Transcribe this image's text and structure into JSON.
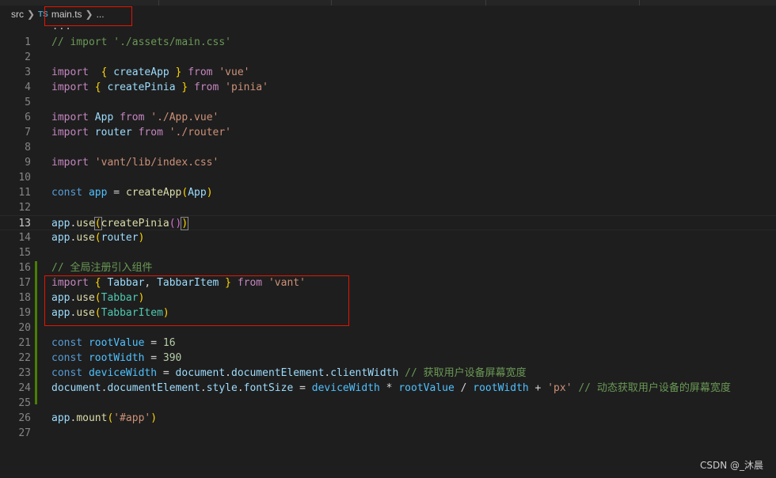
{
  "breadcrumb": {
    "folder": "src",
    "file_badge": "TS",
    "file": "main.ts",
    "tail": "..."
  },
  "sticky": "...",
  "lines": [
    {
      "n": "1",
      "parts": [
        [
          "cm",
          "// import './assets/main.css'"
        ]
      ]
    },
    {
      "n": "2",
      "parts": []
    },
    {
      "n": "3",
      "parts": [
        [
          "kw",
          "import"
        ],
        [
          "",
          "  "
        ],
        [
          "br1",
          "{"
        ],
        [
          "",
          ""
        ],
        [
          "var",
          " createApp "
        ],
        [
          "br1",
          "}"
        ],
        [
          "kw",
          " from "
        ],
        [
          "st",
          "'vue'"
        ]
      ]
    },
    {
      "n": "4",
      "parts": [
        [
          "kw",
          "import"
        ],
        [
          "",
          ""
        ],
        [
          "br1",
          " {"
        ],
        [
          "var",
          " createPinia "
        ],
        [
          "br1",
          "}"
        ],
        [
          "kw",
          " from "
        ],
        [
          "st",
          "'pinia'"
        ]
      ]
    },
    {
      "n": "5",
      "parts": []
    },
    {
      "n": "6",
      "parts": [
        [
          "kw",
          "import"
        ],
        [
          "var",
          " App"
        ],
        [
          "kw",
          " from "
        ],
        [
          "st",
          "'./App.vue'"
        ]
      ]
    },
    {
      "n": "7",
      "parts": [
        [
          "kw",
          "import"
        ],
        [
          "var",
          " router"
        ],
        [
          "kw",
          " from "
        ],
        [
          "st",
          "'./router'"
        ]
      ]
    },
    {
      "n": "8",
      "parts": []
    },
    {
      "n": "9",
      "parts": [
        [
          "kw",
          "import"
        ],
        [
          "st",
          " 'vant/lib/index.css'"
        ]
      ]
    },
    {
      "n": "10",
      "parts": []
    },
    {
      "n": "11",
      "parts": [
        [
          "st-kw",
          "const"
        ],
        [
          "cst",
          " app"
        ],
        [
          "",
          " = "
        ],
        [
          "fn",
          "createApp"
        ],
        [
          "br1",
          "("
        ],
        [
          "var",
          "App"
        ],
        [
          "br1",
          ")"
        ]
      ]
    },
    {
      "n": "12",
      "parts": []
    },
    {
      "n": "13",
      "parts": [
        [
          "var",
          "app"
        ],
        [
          "",
          "."
        ],
        [
          "fn",
          "use"
        ],
        [
          "br1 bm",
          "("
        ],
        [
          "fn",
          "createPinia"
        ],
        [
          "br2",
          "()"
        ],
        [
          "br1 bm",
          ")"
        ]
      ]
    },
    {
      "n": "14",
      "parts": [
        [
          "var",
          "app"
        ],
        [
          "",
          "."
        ],
        [
          "fn",
          "use"
        ],
        [
          "br1",
          "("
        ],
        [
          "var",
          "router"
        ],
        [
          "br1",
          ")"
        ]
      ]
    },
    {
      "n": "15",
      "parts": []
    },
    {
      "n": "16",
      "parts": [
        [
          "cm",
          "// "
        ],
        [
          "cmcn",
          "全局注册引入组件"
        ]
      ]
    },
    {
      "n": "17",
      "parts": [
        [
          "kw",
          "import"
        ],
        [
          "",
          ""
        ],
        [
          "br1",
          " {"
        ],
        [
          "var",
          " Tabbar"
        ],
        [
          "",
          ", "
        ],
        [
          "var",
          "TabbarItem "
        ],
        [
          "br1",
          "}"
        ],
        [
          "kw",
          " from "
        ],
        [
          "st",
          "'vant'"
        ]
      ]
    },
    {
      "n": "18",
      "parts": [
        [
          "var",
          "app"
        ],
        [
          "",
          "."
        ],
        [
          "fn",
          "use"
        ],
        [
          "br1",
          "("
        ],
        [
          "cls",
          "Tabbar"
        ],
        [
          "br1",
          ")"
        ]
      ]
    },
    {
      "n": "19",
      "parts": [
        [
          "var",
          "app"
        ],
        [
          "",
          "."
        ],
        [
          "fn",
          "use"
        ],
        [
          "br1",
          "("
        ],
        [
          "cls",
          "TabbarItem"
        ],
        [
          "br1",
          ")"
        ]
      ]
    },
    {
      "n": "20",
      "parts": []
    },
    {
      "n": "21",
      "parts": [
        [
          "st-kw",
          "const"
        ],
        [
          "cst",
          " rootValue"
        ],
        [
          "",
          " = "
        ],
        [
          "num",
          "16"
        ]
      ]
    },
    {
      "n": "22",
      "parts": [
        [
          "st-kw",
          "const"
        ],
        [
          "cst",
          " rootWidth"
        ],
        [
          "",
          " = "
        ],
        [
          "num",
          "390"
        ]
      ]
    },
    {
      "n": "23",
      "parts": [
        [
          "st-kw",
          "const"
        ],
        [
          "cst",
          " deviceWidth"
        ],
        [
          "",
          " = "
        ],
        [
          "var",
          "document"
        ],
        [
          "",
          "."
        ],
        [
          "var",
          "documentElement"
        ],
        [
          "",
          "."
        ],
        [
          "var",
          "clientWidth"
        ],
        [
          "cm",
          " // "
        ],
        [
          "cmcn",
          "获取用户设备屏幕宽度"
        ]
      ]
    },
    {
      "n": "24",
      "parts": [
        [
          "var",
          "document"
        ],
        [
          "",
          "."
        ],
        [
          "var",
          "documentElement"
        ],
        [
          "",
          "."
        ],
        [
          "var",
          "style"
        ],
        [
          "",
          "."
        ],
        [
          "var",
          "fontSize"
        ],
        [
          "",
          " = "
        ],
        [
          "cst",
          "deviceWidth"
        ],
        [
          "",
          " * "
        ],
        [
          "cst",
          "rootValue"
        ],
        [
          "",
          " / "
        ],
        [
          "cst",
          "rootWidth"
        ],
        [
          "",
          " + "
        ],
        [
          "st",
          "'px'"
        ],
        [
          "cm",
          " // "
        ],
        [
          "cmcn",
          "动态获取用户设备的屏幕宽度"
        ]
      ]
    },
    {
      "n": "25",
      "parts": []
    },
    {
      "n": "26",
      "parts": [
        [
          "var",
          "app"
        ],
        [
          "",
          "."
        ],
        [
          "fn",
          "mount"
        ],
        [
          "br1",
          "("
        ],
        [
          "st",
          "'#app'"
        ],
        [
          "br1",
          ")"
        ]
      ]
    },
    {
      "n": "27",
      "parts": []
    }
  ],
  "active_line": "13",
  "watermark": "CSDN @_沐晨"
}
